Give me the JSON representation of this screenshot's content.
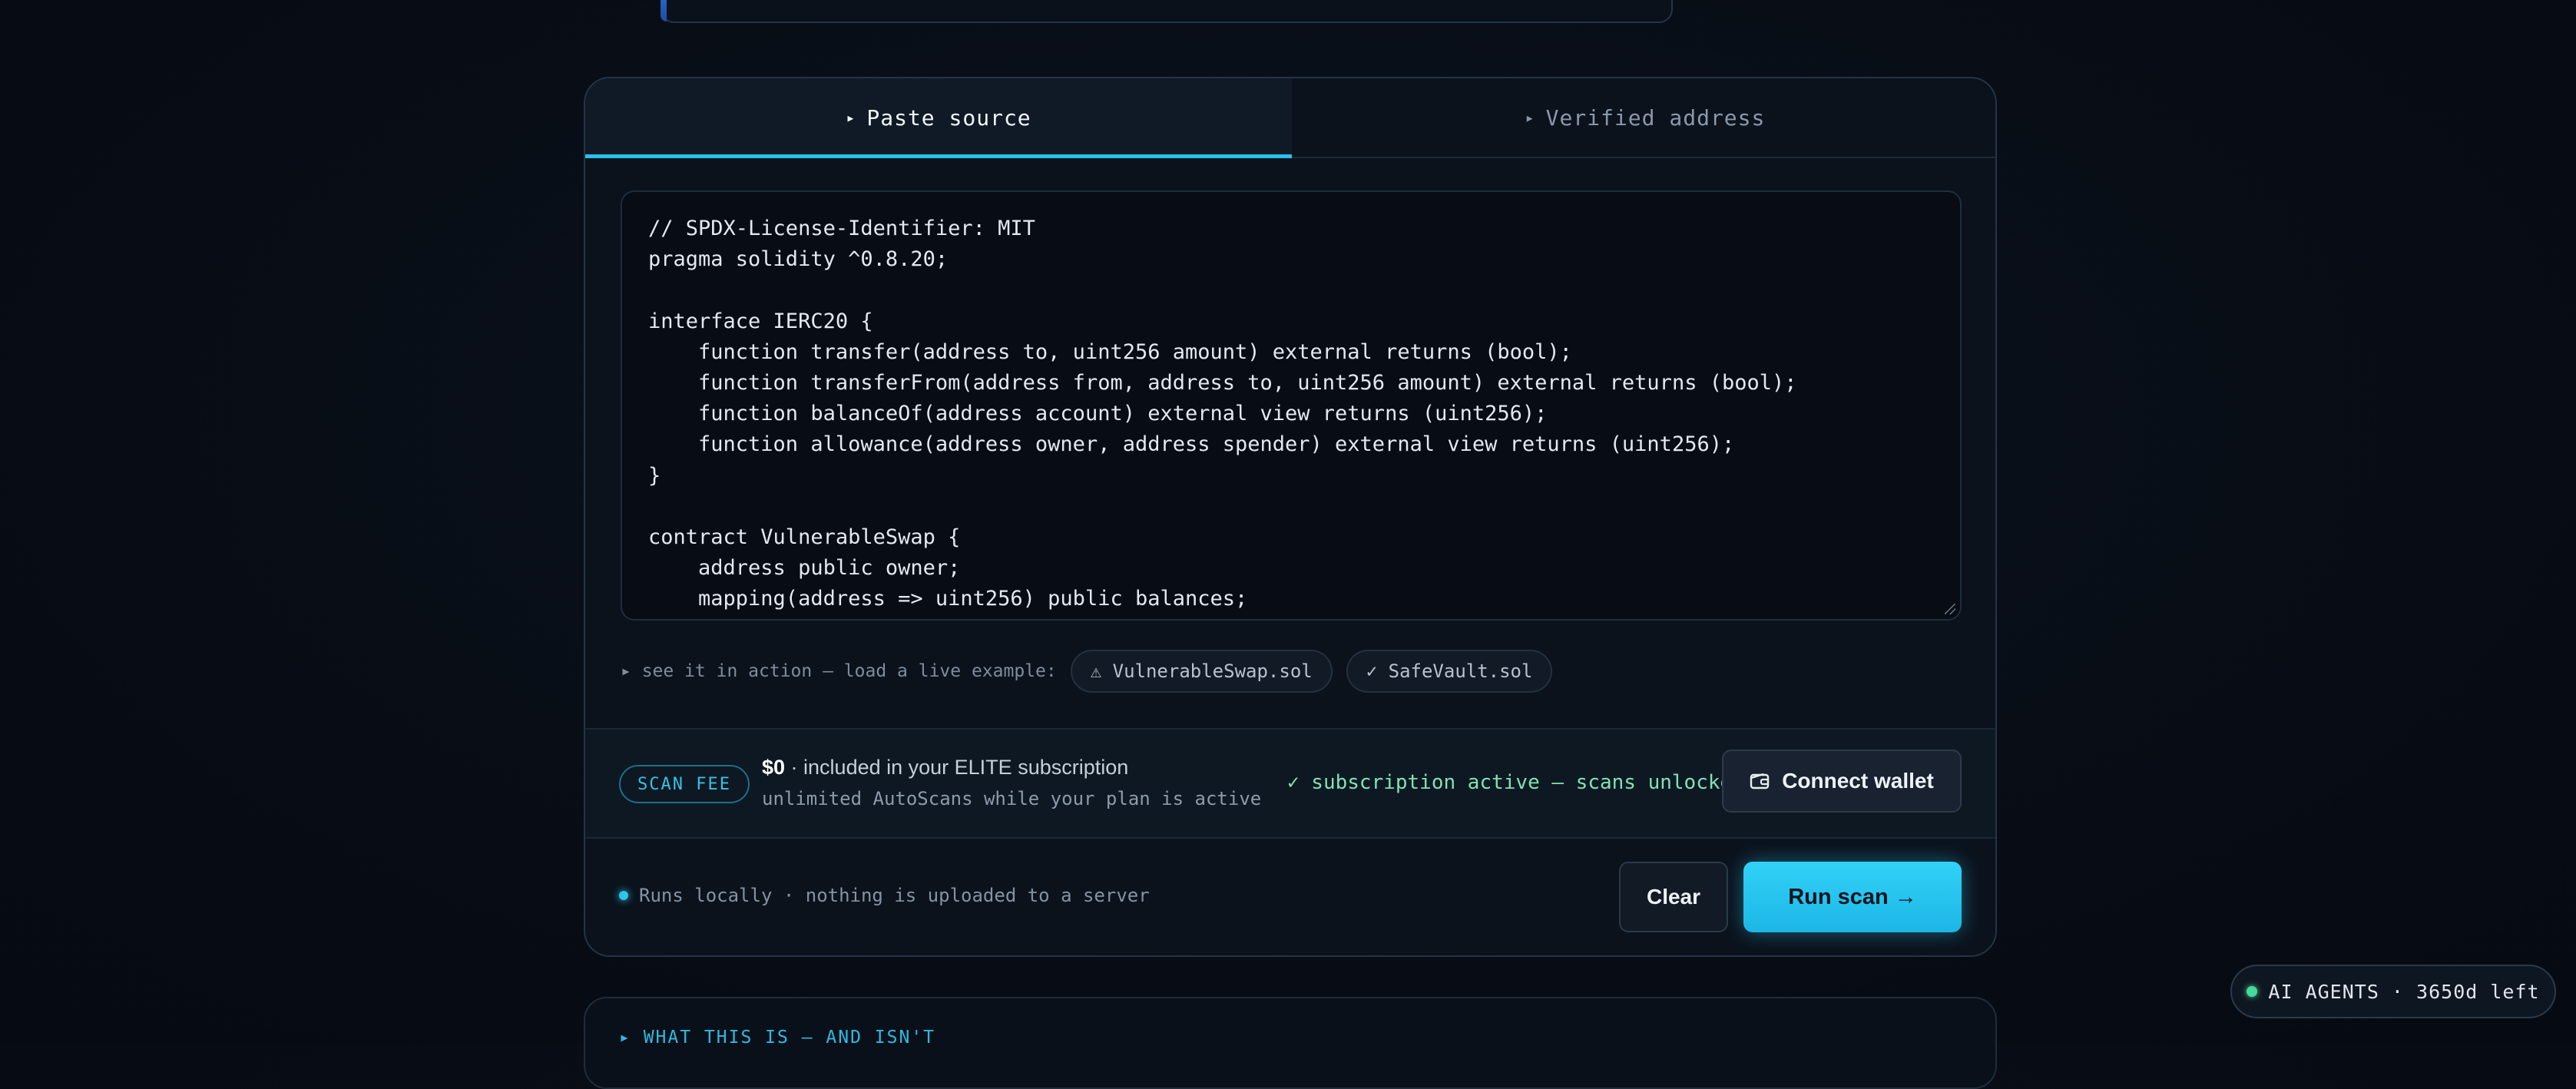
{
  "tabs": [
    {
      "label": "Paste source",
      "active": true
    },
    {
      "label": "Verified address",
      "active": false
    }
  ],
  "editor": {
    "lines": [
      "// SPDX-License-Identifier: MIT",
      "pragma solidity ^0.8.20;",
      "",
      "interface IERC20 {",
      "    function transfer(address to, uint256 amount) external returns (bool);",
      "    function transferFrom(address from, address to, uint256 amount) external returns (bool);",
      "    function balanceOf(address account) external view returns (uint256);",
      "    function allowance(address owner, address spender) external view returns (uint256);",
      "}",
      "",
      "contract VulnerableSwap {",
      "    address public owner;",
      "    mapping(address => uint256) public balances;"
    ]
  },
  "examples": {
    "hint": "▸ see it in action — load a live example:",
    "items": [
      {
        "icon": "warning-icon",
        "label": "⚠ VulnerableSwap.sol"
      },
      {
        "icon": "check-icon",
        "label": "✓ SafeVault.sol"
      }
    ]
  },
  "fee": {
    "badge": "SCAN FEE",
    "amount": "$0",
    "main_text": " · included in your ELITE subscription",
    "sub_text": "unlimited AutoScans while your plan is active",
    "status": "✓ subscription active — scans unlocked",
    "wallet_button": "Connect wallet"
  },
  "footer": {
    "note": "Runs locally · nothing is uploaded to a server",
    "clear_button": "Clear",
    "run_button": "Run scan →"
  },
  "next_section": {
    "title": "▸ WHAT THIS IS — AND ISN'T"
  },
  "agents_pill": {
    "label": "AI AGENTS · 3650d left"
  },
  "colors": {
    "accent": "#29c1ec",
    "success": "#47d89c",
    "background": "#080d16"
  }
}
